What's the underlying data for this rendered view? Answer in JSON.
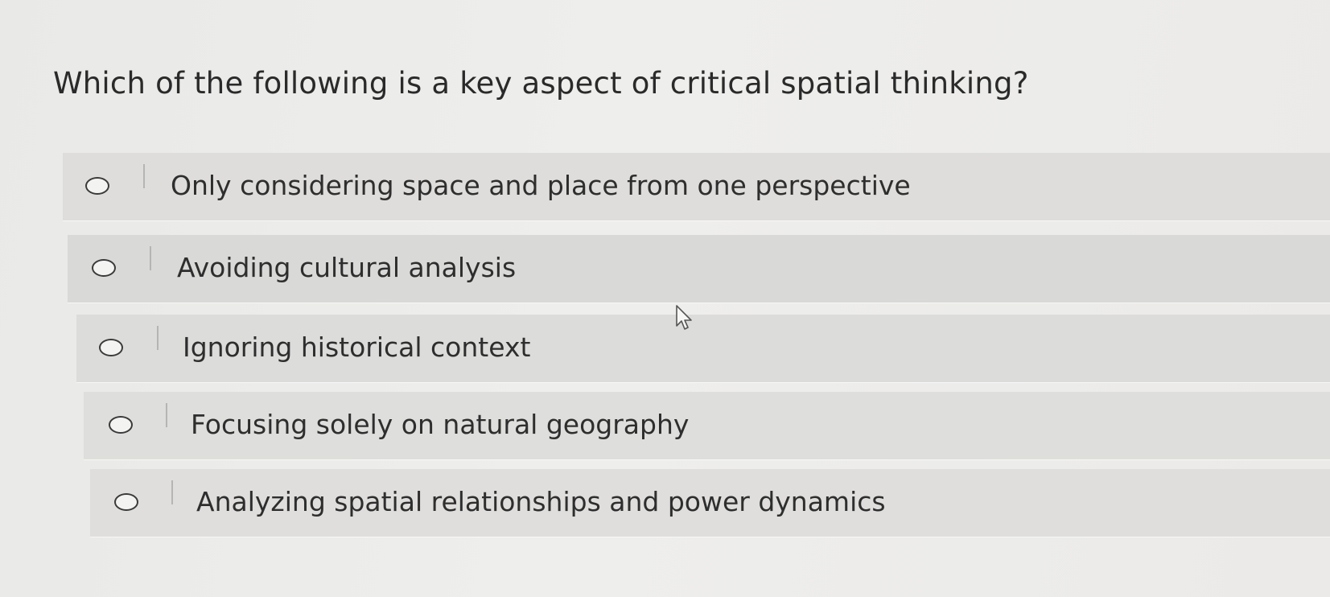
{
  "question": {
    "text": "Which of the following is a key aspect of critical spatial thinking?"
  },
  "options": [
    {
      "label": "Only considering space and place from one perspective",
      "selected": false
    },
    {
      "label": "Avoiding cultural analysis",
      "selected": false
    },
    {
      "label": "Ignoring historical context",
      "selected": false
    },
    {
      "label": "Focusing solely on natural geography",
      "selected": false
    },
    {
      "label": "Analyzing spatial relationships and power dynamics",
      "selected": false
    }
  ],
  "icons": {
    "radio": "radio-button-icon",
    "cursor": "mouse-pointer-icon"
  }
}
